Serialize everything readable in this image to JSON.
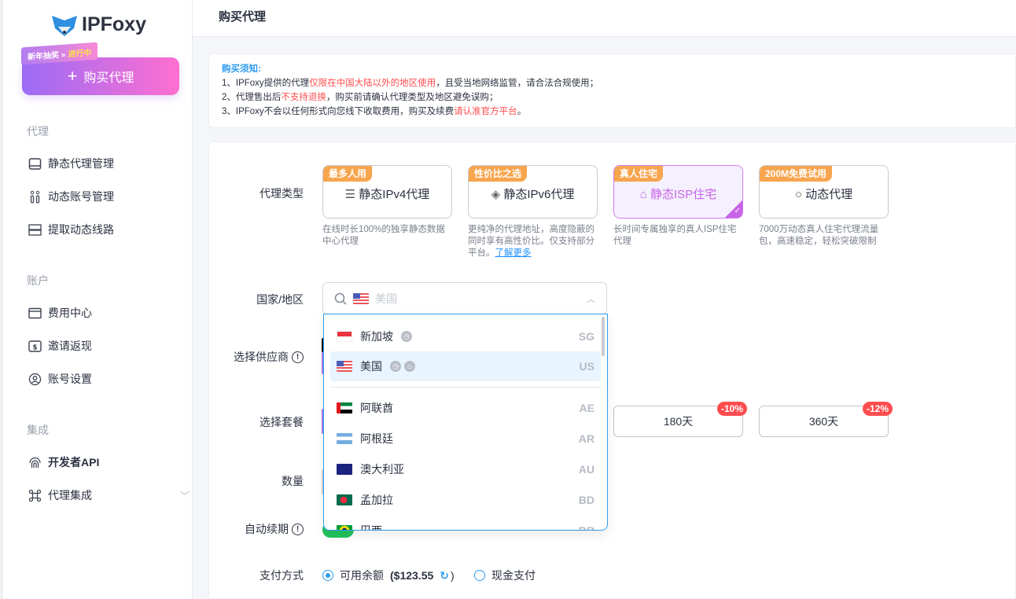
{
  "sidebar": {
    "logo": "IPFoxy",
    "promo": {
      "text": "新年抽奖 »",
      "highlight": "进行中"
    },
    "buy_button": "购买代理",
    "sections": [
      {
        "title": "代理",
        "items": [
          {
            "label": "静态代理管理",
            "icon": "monitor-icon"
          },
          {
            "label": "动态账号管理",
            "icon": "accounts-icon"
          },
          {
            "label": "提取动态线路",
            "icon": "server-icon"
          }
        ]
      },
      {
        "title": "账户",
        "items": [
          {
            "label": "费用中心",
            "icon": "card-icon"
          },
          {
            "label": "邀请返现",
            "icon": "dollar-icon"
          },
          {
            "label": "账号设置",
            "icon": "user-icon"
          }
        ]
      },
      {
        "title": "集成",
        "items": [
          {
            "label": "开发者API",
            "icon": "fingerprint-icon"
          },
          {
            "label": "代理集成",
            "icon": "integration-icon"
          }
        ]
      }
    ]
  },
  "header": {
    "title": "购买代理"
  },
  "notice": {
    "title": "购买须知:",
    "lines": [
      {
        "a": "1、IPFoxy提供的代理",
        "b": "仅限在中国大陆以外的地区使用",
        "c": "，且受当地网络监管，请合法合规使用；"
      },
      {
        "a": "2、代理售出后",
        "b": "不支持退换",
        "c": "，购买前请确认代理类型及地区避免误购；"
      },
      {
        "a": "3、IPFoxy不会以任何形式向您线下收取费用，购买及续费",
        "b": "请认准官方平台",
        "c": "。"
      }
    ]
  },
  "form": {
    "labels": {
      "type": "代理类型",
      "country": "国家/地区",
      "provider": "选择供应商",
      "plan": "选择套餐",
      "quantity": "数量",
      "auto_renew": "自动续期",
      "payment": "支付方式"
    },
    "proxy_types": [
      {
        "tag": "最多人用",
        "name": "静态IPv4代理",
        "desc": "在线时长100%的独享静态数据中心代理"
      },
      {
        "tag": "性价比之选",
        "name": "静态IPv6代理",
        "desc": "更纯净的代理地址，高度隐蔽的同时享有高性价比。仅支持部分平台。",
        "link": "了解更多"
      },
      {
        "tag": "真人住宅",
        "name": "静态ISP住宅",
        "desc": "长时间专属独享的真人ISP住宅代理",
        "selected": true
      },
      {
        "tag": "200M免费试用",
        "name": "动态代理",
        "desc": "7000万动态真人住宅代理流量包，高速稳定，轻松突破限制"
      }
    ],
    "country": {
      "placeholder": "美国",
      "options": [
        {
          "name": "新加坡",
          "code": "SG"
        },
        {
          "name": "美国",
          "code": "US",
          "highlighted": true
        },
        {
          "name": "阿联酋",
          "code": "AE"
        },
        {
          "name": "阿根廷",
          "code": "AR"
        },
        {
          "name": "澳大利亚",
          "code": "AU"
        },
        {
          "name": "孟加拉",
          "code": "BD"
        },
        {
          "name": "巴西",
          "code": "BR"
        }
      ]
    },
    "plans": [
      {
        "label": "180天",
        "discount": "-10%"
      },
      {
        "label": "360天",
        "discount": "-12%"
      }
    ],
    "payment": {
      "balance_label": "可用余额",
      "balance": "($123.55",
      "close": ")",
      "cash": "现金支付",
      "selected": "balance"
    }
  }
}
